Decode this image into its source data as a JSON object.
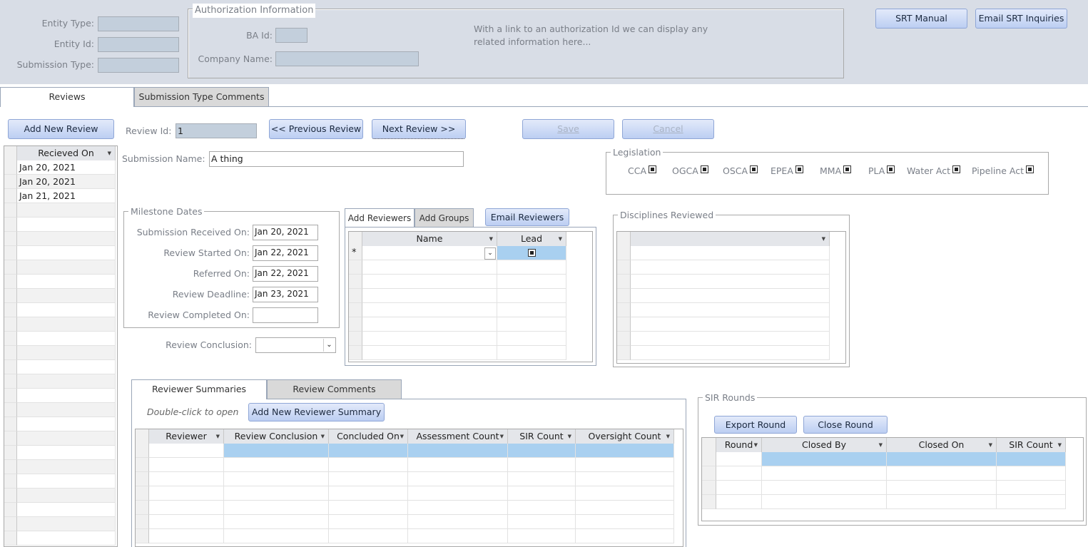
{
  "header": {
    "entity_type_label": "Entity Type:",
    "entity_id_label": "Entity Id:",
    "submission_type_label": "Submission Type:",
    "auth_legend": "Authorization Information",
    "ba_id_label": "BA Id:",
    "company_name_label": "Company Name:",
    "auth_note_1": "With a link to an authorization Id we can display any",
    "auth_note_2": "related information here...",
    "srt_manual": "SRT Manual",
    "email_srt": "Email SRT Inquiries"
  },
  "tabs": {
    "reviews": "Reviews",
    "submission_type_comments": "Submission Type Comments"
  },
  "toolbar": {
    "add_new_review": "Add New Review",
    "review_id_label": "Review Id:",
    "review_id_value": "1",
    "previous": "<< Previous Review",
    "next": "Next Review >>",
    "save": "Save",
    "cancel": "Cancel"
  },
  "review_list": {
    "columns": [
      "Recieved On"
    ],
    "rows": [
      [
        "Jan 20, 2021"
      ],
      [
        "Jan 20, 2021"
      ],
      [
        "Jan 21, 2021"
      ]
    ]
  },
  "submission": {
    "label": "Submission Name:",
    "value": "A thing"
  },
  "legislation": {
    "legend": "Legislation",
    "items": [
      "CCA",
      "OGCA",
      "OSCA",
      "EPEA",
      "MMA",
      "PLA",
      "Water Act",
      "Pipeline Act"
    ]
  },
  "milestones": {
    "legend": "Milestone Dates",
    "fields": [
      {
        "label": "Submission Received On:",
        "value": "Jan 20, 2021"
      },
      {
        "label": "Review Started On:",
        "value": "Jan 22, 2021"
      },
      {
        "label": "Referred On:",
        "value": "Jan 22, 2021"
      },
      {
        "label": "Review Deadline:",
        "value": "Jan 23, 2021"
      },
      {
        "label": "Review Completed On:",
        "value": ""
      }
    ],
    "conclusion_label": "Review Conclusion:",
    "conclusion_value": ""
  },
  "reviewers": {
    "tab_add_reviewers": "Add Reviewers",
    "tab_add_groups": "Add Groups",
    "email_reviewers": "Email Reviewers",
    "columns": [
      "Name",
      "Lead"
    ],
    "new_row_marker": "*"
  },
  "disciplines": {
    "legend": "Disciplines Reviewed",
    "columns": [
      ""
    ]
  },
  "summaries": {
    "tab_reviewer_summaries": "Reviewer Summaries",
    "tab_review_comments": "Review Comments",
    "hint": "Double-click to open",
    "add_button": "Add New Reviewer Summary",
    "columns": [
      "Reviewer",
      "Review Conclusion",
      "Concluded On",
      "Assessment Count",
      "SIR Count",
      "Oversight Count"
    ]
  },
  "sir_rounds": {
    "legend": "SIR Rounds",
    "export_round": "Export Round",
    "close_round": "Close Round",
    "columns": [
      "Round",
      "Closed By",
      "Closed On",
      "SIR Count"
    ]
  }
}
